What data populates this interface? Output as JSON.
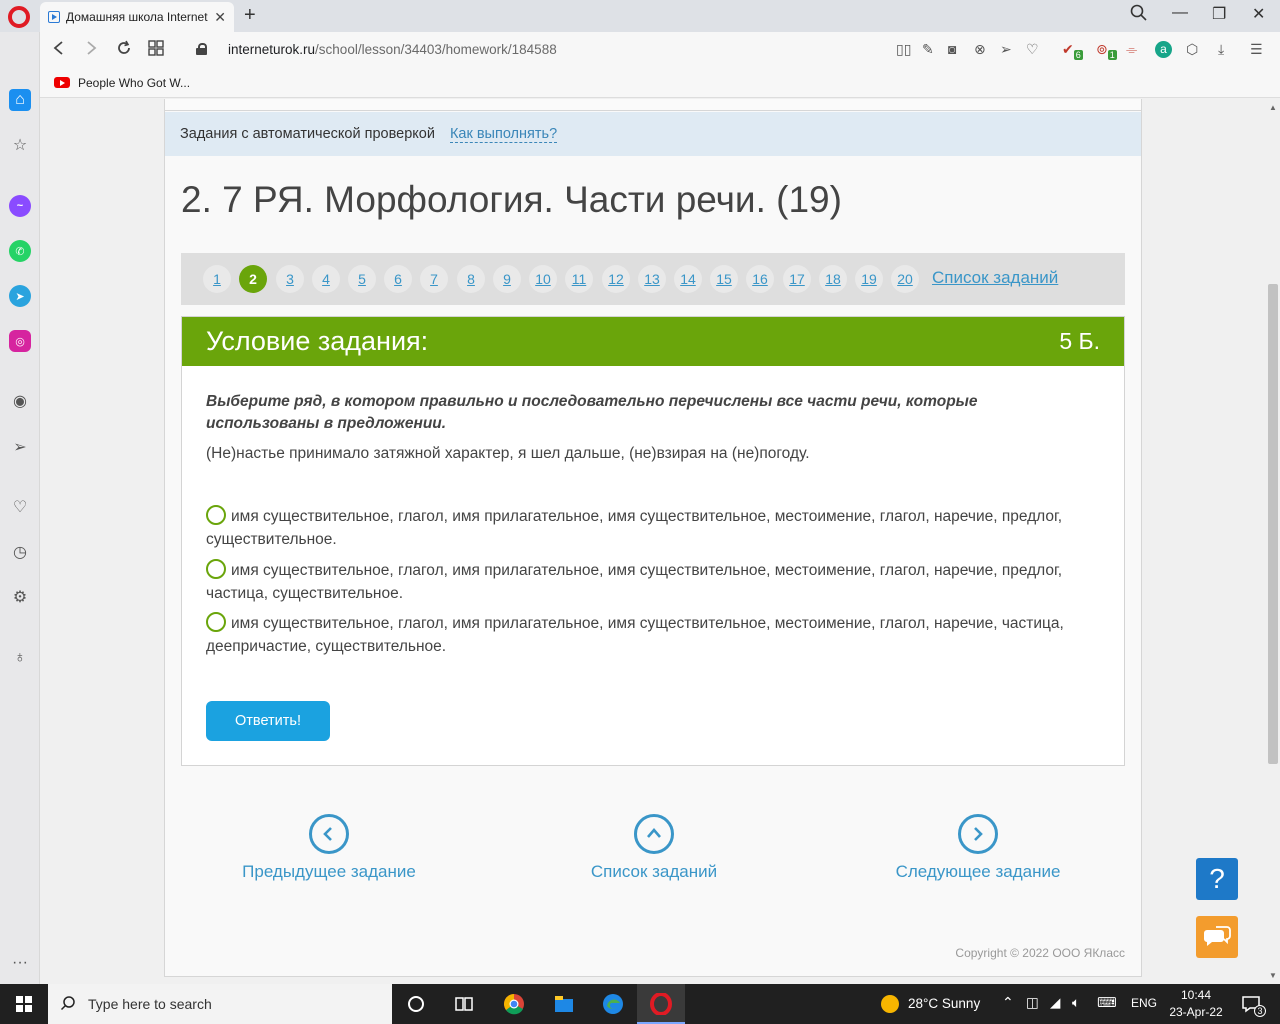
{
  "browser": {
    "tab_title": "Домашняя школа Internet",
    "url_host": "interneturok.ru",
    "url_path": "/school/lesson/34403/homework/184588",
    "bookmark_label": "People Who Got W..."
  },
  "page": {
    "info_text": "Задания с автоматической проверкой",
    "info_link": "Как выполнять?",
    "lesson_title": "2. 7 РЯ. Морфология. Части речи. (19)",
    "pager": {
      "pages": [
        "1",
        "2",
        "3",
        "4",
        "5",
        "6",
        "7",
        "8",
        "9",
        "10",
        "11",
        "12",
        "13",
        "14",
        "15",
        "16",
        "17",
        "18",
        "19",
        "20"
      ],
      "active": "2",
      "list_link": "Список заданий"
    },
    "task": {
      "heading": "Условие задания:",
      "points": "5 Б.",
      "question": "Выберите ряд, в котором правильно и последовательно перечислены все части речи, которые использованы в предложении.",
      "sentence": "(Не)настье принимало затяжной характер, я шел дальше, (не)взирая на (не)погоду.",
      "options": [
        "имя существительное, глагол, имя прилагательное, имя существительное, местоимение, глагол, наречие, предлог, существительное.",
        "имя существительное, глагол, имя прилагательное, имя существительное, местоимение, глагол, наречие, предлог, частица, существительное.",
        "имя существительное, глагол, имя прилагательное, имя существительное, местоимение, глагол, наречие, частица, деепричастие, существительное."
      ],
      "answer_button": "Ответить!"
    },
    "nav": {
      "prev": "Предыдущее задание",
      "list": "Список заданий",
      "next": "Следующее задание"
    },
    "copyright": "Copyright © 2022 ООО ЯКласс",
    "help_button": "?"
  },
  "taskbar": {
    "search_placeholder": "Type here to search",
    "weather": "28°C  Sunny",
    "language": "ENG",
    "time": "10:44",
    "date": "23-Apr-22",
    "notifications": "3"
  },
  "extension_badges": {
    "badge_a": "6",
    "badge_b": "1"
  },
  "colors": {
    "accent_green": "#6aa50b",
    "link_blue": "#3a96c8",
    "button_blue": "#1ba2e0"
  }
}
